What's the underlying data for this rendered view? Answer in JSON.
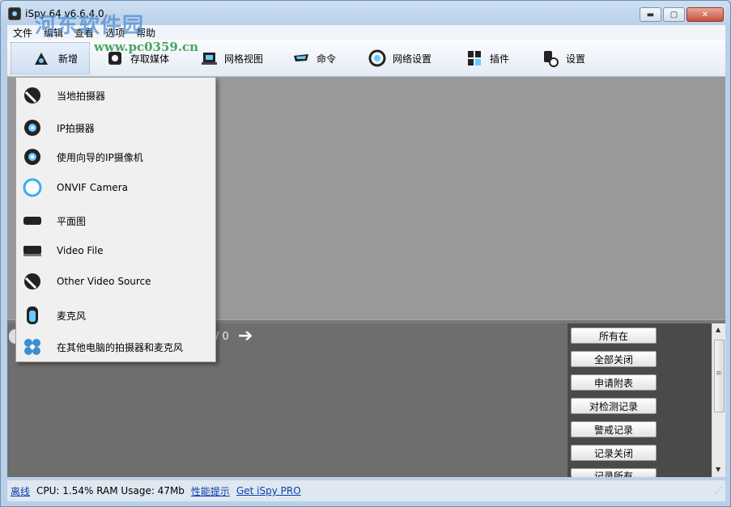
{
  "window": {
    "title": "iSpy 64 v6.6.4.0"
  },
  "watermark": {
    "text": "河东软件园",
    "url": "www.pc0359.cn"
  },
  "window_buttons": {
    "minimize": "▬",
    "maximize": "▢",
    "close": "✕"
  },
  "menubar": [
    "文件",
    "编辑",
    "查看",
    "选项",
    "帮助"
  ],
  "toolbar": [
    {
      "label": "新增",
      "icon": "add-camera-icon"
    },
    {
      "label": "存取媒体",
      "icon": "media-icon"
    },
    {
      "label": "网格视图",
      "icon": "grid-view-icon"
    },
    {
      "label": "命令",
      "icon": "command-icon"
    },
    {
      "label": "网络设置",
      "icon": "network-icon"
    },
    {
      "label": "插件",
      "icon": "plugin-icon"
    },
    {
      "label": "设置",
      "icon": "settings-icon"
    }
  ],
  "dropdown": [
    {
      "label": "当地拍摄器",
      "icon": "local-camera-icon"
    },
    {
      "label": "IP拍摄器",
      "icon": "ip-camera-icon"
    },
    {
      "label": "使用向导的IP摄像机",
      "icon": "ip-wizard-icon"
    },
    {
      "label": "ONVIF Camera",
      "icon": "onvif-icon"
    },
    {
      "label": "平面图",
      "icon": "floorplan-icon"
    },
    {
      "label": "Video File",
      "icon": "video-file-icon"
    },
    {
      "label": "Other Video Source",
      "icon": "other-source-icon"
    },
    {
      "label": "麦克风",
      "icon": "microphone-icon"
    },
    {
      "label": "在其他电脑的拍摄器和麦克风",
      "icon": "remote-icon"
    }
  ],
  "pager": {
    "text": "/ 0",
    "next": "➔"
  },
  "side_buttons": [
    "所有在",
    "全部关闭",
    "申请附表",
    "对检测记录",
    "警戒记录",
    "记录关闭",
    "记录所有"
  ],
  "status": {
    "offline": "离线",
    "stats": "CPU: 1.54% RAM Usage: 47Mb",
    "perf": "性能提示",
    "pro": "Get iSpy PRO"
  },
  "scrollbar": {
    "up": "▲",
    "down": "▼",
    "grip": "≡"
  }
}
